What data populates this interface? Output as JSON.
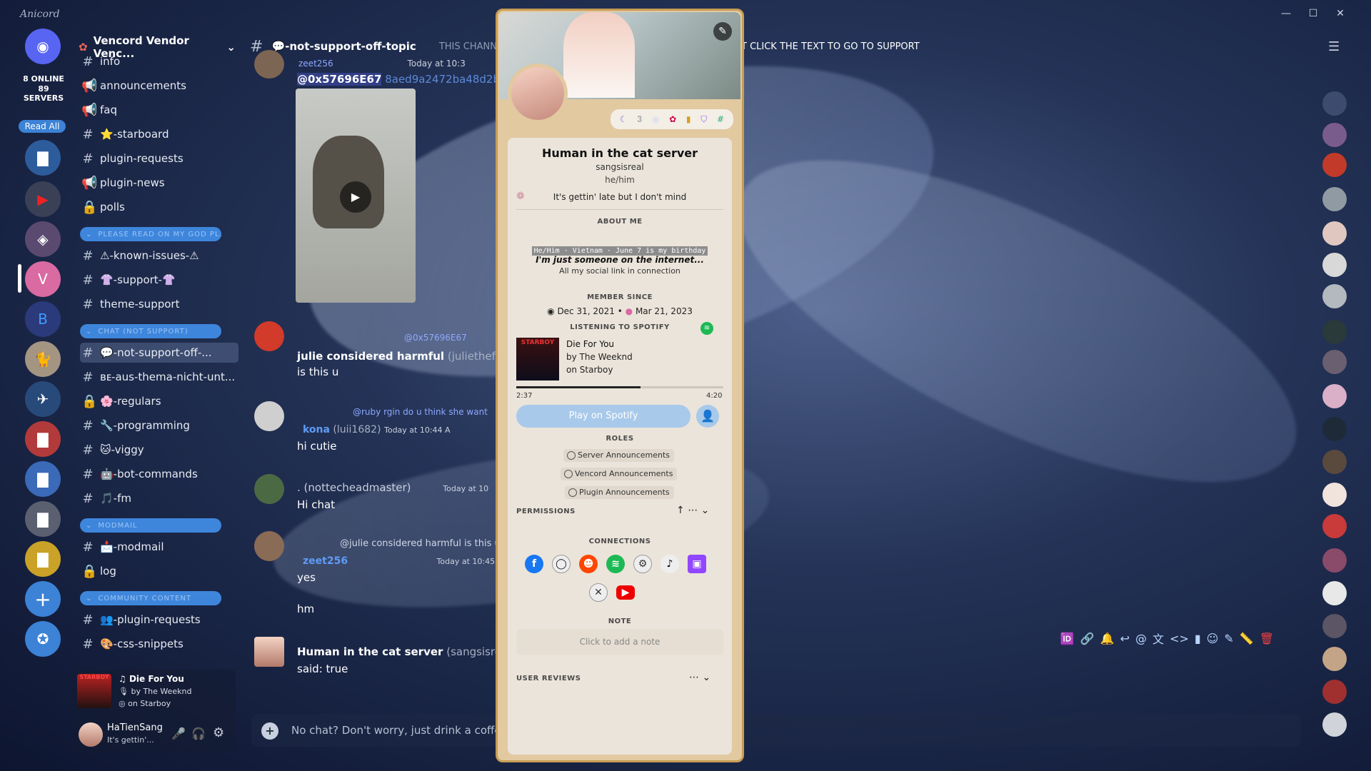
{
  "app": {
    "brand": "Anicord",
    "window_controls": [
      "—",
      "☐",
      "✕"
    ]
  },
  "rail": {
    "online": "8 ONLINE",
    "servers": "89 SERVERS",
    "read_all": "Read All"
  },
  "guild": {
    "name": "Vencord Vendor Venc..."
  },
  "channels": [
    {
      "icon": "#",
      "label": "info"
    },
    {
      "icon": "📢",
      "label": "announcements"
    },
    {
      "icon": "📢",
      "label": "faq"
    },
    {
      "icon": "#",
      "label": "⭐-starboard"
    },
    {
      "icon": "#",
      "label": "plugin-requests"
    },
    {
      "icon": "📢",
      "label": "plugin-news"
    },
    {
      "icon": "🔒",
      "label": "polls"
    },
    {
      "icon": "#",
      "label": "⚠-known-issues-⚠"
    },
    {
      "icon": "#",
      "label": "👚-support-👚"
    },
    {
      "icon": "#",
      "label": "theme-support"
    },
    {
      "icon": "#",
      "label": "💬-not-support-off-..."
    },
    {
      "icon": "#",
      "label": "ʙᴇ-aus-thema-nicht-unt..."
    },
    {
      "icon": "🔒",
      "label": "🌸-regulars"
    },
    {
      "icon": "#",
      "label": "🔧-programming"
    },
    {
      "icon": "#",
      "label": "🐱-viggy"
    },
    {
      "icon": "#",
      "label": "🤖-bot-commands"
    },
    {
      "icon": "#",
      "label": "🎵-fm"
    },
    {
      "icon": "#",
      "label": "📩-modmail"
    },
    {
      "icon": "🔒",
      "label": "log"
    },
    {
      "icon": "#",
      "label": "👥-plugin-requests"
    },
    {
      "icon": "#",
      "label": "🎨-css-snippets"
    }
  ],
  "categories": [
    "PLEASE READ ON MY GOD PL...",
    "CHAT (NOT SUPPORT)",
    "MODMAIL",
    "COMMUNITY CONTENT"
  ],
  "now_playing": {
    "title": "Die For You",
    "artist": "by The Weeknd",
    "album": "on Starboy"
  },
  "user": {
    "name": "HaTienSang",
    "status": "It's gettin'..."
  },
  "chat": {
    "channel": "💬-not-support-off-topic",
    "topic": "THIS CHANNEL",
    "topic_tail": "T CLICK THE TEXT TO GO TO SUPPORT",
    "input_placeholder": "No chat? Don't worry, just drink a coffee cu",
    "messages": [
      {
        "reply_user": "zeet256",
        "time": "Today at 10:3",
        "text": "@0x57696E67",
        "link": "8aed9a2472ba48d2b"
      },
      {
        "reply": "@0x57696E67",
        "author": "julie considered harmful",
        "tag": "(juliethefoxco",
        "text": "is this u"
      },
      {
        "reply": "@ruby rgin do u think she want",
        "author": "kona",
        "tag": "(luii1682)",
        "time": "Today at 10:44 A",
        "text": "hi cutie"
      },
      {
        "author": ". (nottecheadmaster)",
        "time": "Today at 10",
        "text": "Hi chat"
      },
      {
        "reply": "@julie considered harmful is this u",
        "author": "zeet256",
        "time": "Today at 10:45",
        "text": "yes"
      },
      {
        "text": "hm"
      },
      {
        "author": "Human in the cat server",
        "tag": "(sangsisreal)",
        "text": "said: true"
      }
    ]
  },
  "popout": {
    "display_name": "Human in the cat server",
    "username": "sangsisreal",
    "pronouns": "he/him",
    "custom_status": "It's gettin' late but I don't mind",
    "about_header": "ABOUT ME",
    "about_line1": "He/Him · Vietnam · June 7 is my birthday",
    "about_line2": "I'm just someone on the internet...",
    "about_line3": "All my social link in connection",
    "member_since_header": "MEMBER SINCE",
    "discord_since": "Dec 31, 2021",
    "server_since": "Mar 21, 2023",
    "listening_header": "LISTENING TO SPOTIFY",
    "track": "Die For You",
    "artist": "by The Weeknd",
    "album": "on Starboy",
    "album_art_text": "STARBOY",
    "elapsed": "2:37",
    "duration": "4:20",
    "progress": 0.6,
    "play_button": "Play on Spotify",
    "roles_header": "ROLES",
    "roles": [
      "Server Announcements",
      "Vencord Announcements",
      "Plugin Announcements"
    ],
    "permissions_header": "PERMISSIONS",
    "connections_header": "CONNECTIONS",
    "note_header": "NOTE",
    "note_placeholder": "Click to add a note",
    "reviews_header": "USER REVIEWS"
  }
}
